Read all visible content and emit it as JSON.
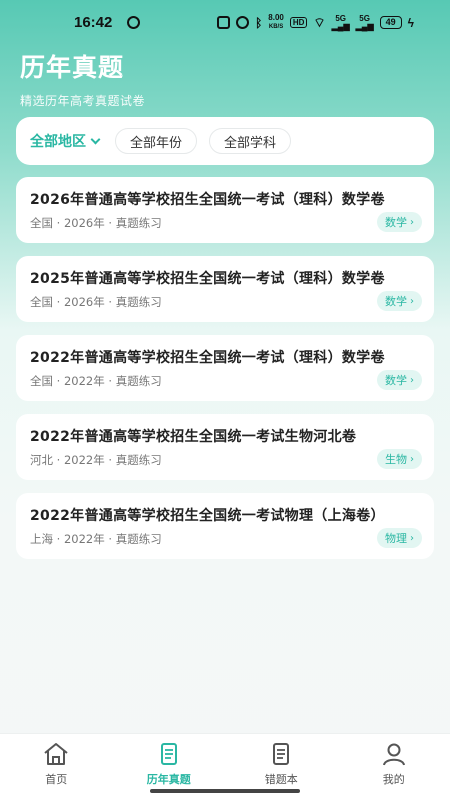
{
  "status_bar": {
    "time": "16:42",
    "speed": "8.00",
    "speed_unit": "KB/S",
    "hd": "HD",
    "net1": "5G",
    "net2": "5G",
    "battery": "49"
  },
  "header": {
    "title": "历年真题",
    "subtitle": "精选历年高考真题试卷"
  },
  "filters": [
    {
      "label": "全部地区",
      "active": true
    },
    {
      "label": "全部年份",
      "active": false
    },
    {
      "label": "全部学科",
      "active": false
    }
  ],
  "papers": [
    {
      "title": "2026年普通高等学校招生全国统一考试（理科）数学卷",
      "meta": "全国 · 2026年 · 真题练习",
      "tag": "数学"
    },
    {
      "title": "2025年普通高等学校招生全国统一考试（理科）数学卷",
      "meta": "全国 · 2026年 · 真题练习",
      "tag": "数学"
    },
    {
      "title": "2022年普通高等学校招生全国统一考试（理科）数学卷",
      "meta": "全国 · 2022年 · 真题练习",
      "tag": "数学"
    },
    {
      "title": "2022年普通高等学校招生全国统一考试生物河北卷",
      "meta": "河北 · 2022年 · 真题练习",
      "tag": "生物"
    },
    {
      "title": "2022年普通高等学校招生全国统一考试物理（上海卷）",
      "meta": "上海 · 2022年 · 真题练习",
      "tag": "物理"
    }
  ],
  "tabs": [
    {
      "label": "首页",
      "icon": "home-icon"
    },
    {
      "label": "历年真题",
      "icon": "paper-list-icon",
      "active": true
    },
    {
      "label": "错题本",
      "icon": "notebook-icon"
    },
    {
      "label": "我的",
      "icon": "user-icon"
    }
  ],
  "colors": {
    "accent": "#2ab7a3",
    "header_bg": "#57c9b4",
    "tag_bg": "#e2f6f2"
  }
}
